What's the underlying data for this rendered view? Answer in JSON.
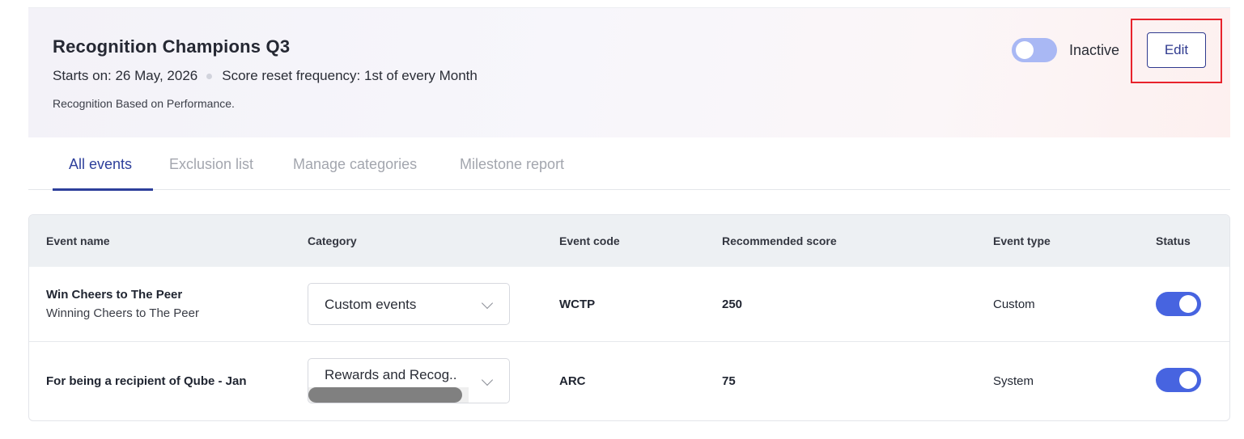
{
  "header": {
    "title": "Recognition Champions Q3",
    "starts_on": "Starts on: 26 May, 2026",
    "reset_frequency": "Score reset frequency: 1st of every Month",
    "description": "Recognition Based on Performance.",
    "status_label": "Inactive",
    "status_active": false,
    "edit_label": "Edit"
  },
  "tabs": [
    {
      "label": "All events",
      "active": true
    },
    {
      "label": "Exclusion list",
      "active": false
    },
    {
      "label": "Manage categories",
      "active": false
    },
    {
      "label": "Milestone report",
      "active": false
    }
  ],
  "table": {
    "columns": [
      "Event name",
      "Category",
      "Event code",
      "Recommended score",
      "Event type",
      "Status"
    ],
    "rows": [
      {
        "name": "Win Cheers to The Peer",
        "subtitle": "Winning Cheers to The Peer",
        "category": "Custom events",
        "code": "WCTP",
        "score": "250",
        "type": "Custom",
        "status_on": true
      },
      {
        "name": "For being a recipient of Qube - Jan",
        "subtitle": "",
        "category": "Rewards and Recog..",
        "code": "ARC",
        "score": "75",
        "type": "System",
        "status_on": true
      }
    ]
  },
  "colors": {
    "accent": "#2d3f9b",
    "toggle_on": "#4764e0",
    "toggle_off": "#a9b8f4",
    "highlight": "#e8232c"
  }
}
